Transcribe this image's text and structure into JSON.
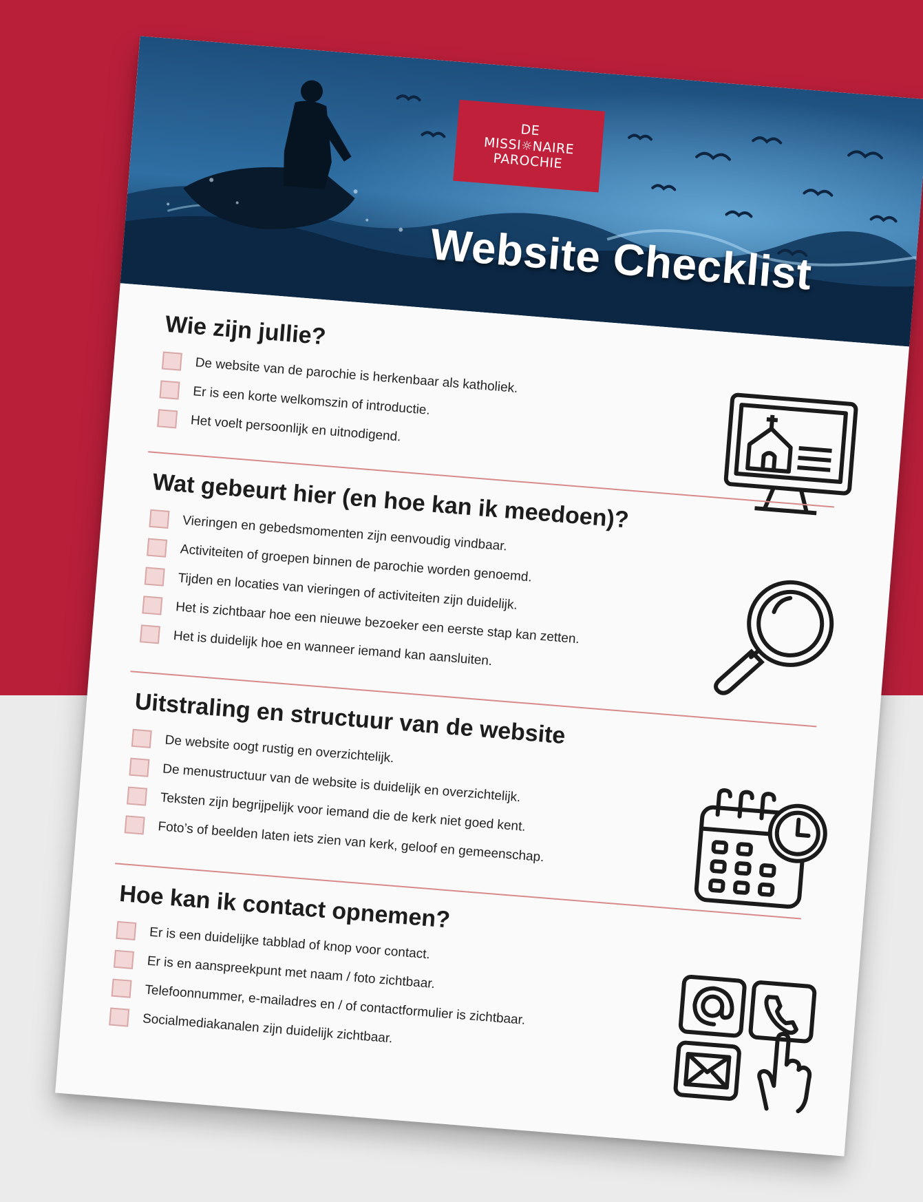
{
  "logo": {
    "line1": "DE",
    "line2a": "MISSI",
    "line2b": "NAIRE",
    "line3": "PAROCHIE"
  },
  "hero": {
    "title": "Website Checklist"
  },
  "sections": [
    {
      "heading": "Wie zijn jullie?",
      "icon": "church-monitor-icon",
      "items": [
        "De website van de parochie is herkenbaar als katholiek.",
        "Er is een korte welkomszin of introductie.",
        "Het voelt persoonlijk en uitnodigend."
      ]
    },
    {
      "heading": "Wat gebeurt hier (en hoe kan ik meedoen)?",
      "icon": "magnifying-glass-icon",
      "items": [
        "Vieringen en gebedsmomenten zijn eenvoudig vindbaar.",
        "Activiteiten of groepen binnen de parochie worden genoemd.",
        "Tijden en locaties van vieringen of activiteiten zijn duidelijk.",
        "Het is zichtbaar hoe een nieuwe bezoeker een eerste stap kan zetten.",
        "Het is duidelijk hoe en wanneer iemand kan aansluiten."
      ]
    },
    {
      "heading": "Uitstraling en structuur van de website",
      "icon": "calendar-clock-icon",
      "items": [
        "De website oogt rustig en overzichtelijk.",
        "De menustructuur van de website is duidelijk en overzichtelijk.",
        "Teksten zijn begrijpelijk voor iemand die de kerk niet goed kent.",
        "Foto’s of beelden laten iets zien van kerk, geloof en gemeenschap."
      ]
    },
    {
      "heading": "Hoe kan ik contact opnemen?",
      "icon": "contact-icons",
      "items": [
        "Er is een duidelijke tabblad of knop voor contact.",
        "Er is en aanspreekpunt met naam / foto zichtbaar.",
        "Telefoonnummer, e-mailadres en / of contactformulier is zichtbaar.",
        "Socialmediakanalen zijn duidelijk zichtbaar."
      ]
    }
  ],
  "colors": {
    "background_top": "#ba1f3a",
    "background_bottom": "#ebebeb",
    "logo_red": "#c0203a",
    "checkbox_fill": "#f3d6d6",
    "divider": "#d88a8a"
  }
}
